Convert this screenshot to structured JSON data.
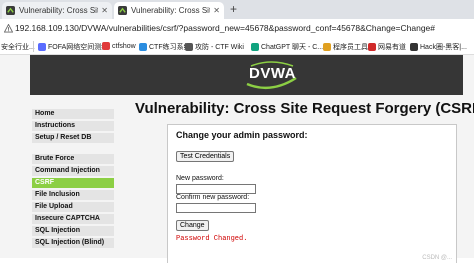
{
  "tabs": [
    {
      "title": "Vulnerability: Cross Site Reque",
      "active": false
    },
    {
      "title": "Vulnerability: Cross Site Reque",
      "active": true
    }
  ],
  "new_tab": "+",
  "address": {
    "url": "192.168.109.130/DVWA/vulnerabilities/csrf/?password_new=45678&password_conf=45678&Change=Change#"
  },
  "bookmarks": [
    {
      "label": "安全行业...",
      "color": "#e05a2a"
    },
    {
      "label": "FOFA网络空间测绘",
      "color": "#5a6cff"
    },
    {
      "label": "ctfshow",
      "color": "#e03a3a"
    },
    {
      "label": "CTF练习系统",
      "color": "#2a8de0"
    },
    {
      "label": "攻防 - CTF Wiki",
      "color": "#555555"
    },
    {
      "label": "ChatGPT 聊天 - C...",
      "color": "#10a37f"
    },
    {
      "label": "程序员工具",
      "color": "#e0a020"
    },
    {
      "label": "网易有道",
      "color": "#d02a2a"
    },
    {
      "label": "Hack圈-黑客|...",
      "color": "#333333"
    }
  ],
  "header": {
    "logo_text": "DVWA"
  },
  "sidebar": {
    "group1": [
      "Home",
      "Instructions",
      "Setup / Reset DB"
    ],
    "group2": [
      "Brute Force",
      "Command Injection",
      "CSRF",
      "File Inclusion",
      "File Upload",
      "Insecure CAPTCHA",
      "SQL Injection",
      "SQL Injection (Blind)"
    ],
    "selected": "CSRF"
  },
  "content": {
    "title": "Vulnerability: Cross Site Request Forgery (CSRF)",
    "subtitle": "Change your admin password:",
    "test_button": "Test Credentials",
    "new_password_label": "New password:",
    "confirm_password_label": "Confirm new password:",
    "new_password_value": "",
    "confirm_password_value": "",
    "change_button": "Change",
    "message": "Password Changed."
  },
  "watermark": "CSDN @..."
}
